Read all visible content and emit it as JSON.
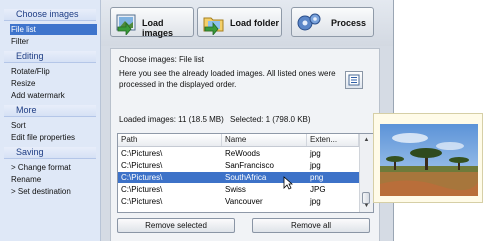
{
  "sidebar": {
    "sections": [
      {
        "title": "Choose images",
        "items": [
          {
            "label": "File list",
            "selected": true
          },
          {
            "label": "Filter"
          }
        ]
      },
      {
        "title": "Editing",
        "items": [
          {
            "label": "Rotate/Flip"
          },
          {
            "label": "Resize"
          },
          {
            "label": "Add watermark"
          }
        ]
      },
      {
        "title": "More",
        "items": [
          {
            "label": "Sort"
          },
          {
            "label": "Edit file properties"
          }
        ]
      },
      {
        "title": "Saving",
        "items": [
          {
            "label": "> Change format"
          },
          {
            "label": "Rename"
          },
          {
            "label": "> Set destination"
          }
        ]
      }
    ]
  },
  "toolbar": {
    "load_images": "Load images",
    "load_folder": "Load folder",
    "process": "Process"
  },
  "panel": {
    "title": "Choose images: File list",
    "description": "Here you see the already loaded images. All listed ones were processed in the displayed order.",
    "loaded": "Loaded images: 11 (18.5 MB)",
    "selected": "Selected: 1 (798.0 KB)"
  },
  "table": {
    "columns": [
      "Path",
      "Name",
      "Exten..."
    ],
    "rows": [
      {
        "path": "C:\\Pictures\\",
        "name": "ReWoods",
        "ext": "jpg",
        "selected": false
      },
      {
        "path": "C:\\Pictures\\",
        "name": "SanFrancisco",
        "ext": "jpg",
        "selected": false
      },
      {
        "path": "C:\\Pictures\\",
        "name": "SouthAfrica",
        "ext": "png",
        "selected": true
      },
      {
        "path": "C:\\Pictures\\",
        "name": "Swiss",
        "ext": "JPG",
        "selected": false
      },
      {
        "path": "C:\\Pictures\\",
        "name": "Vancouver",
        "ext": "jpg",
        "selected": false
      }
    ]
  },
  "buttons": {
    "remove_selected": "Remove selected",
    "remove_all": "Remove all"
  },
  "colors": {
    "selection": "#3d72c8",
    "section_title": "#1e3d84",
    "preview_bg": "#fffbe8"
  }
}
